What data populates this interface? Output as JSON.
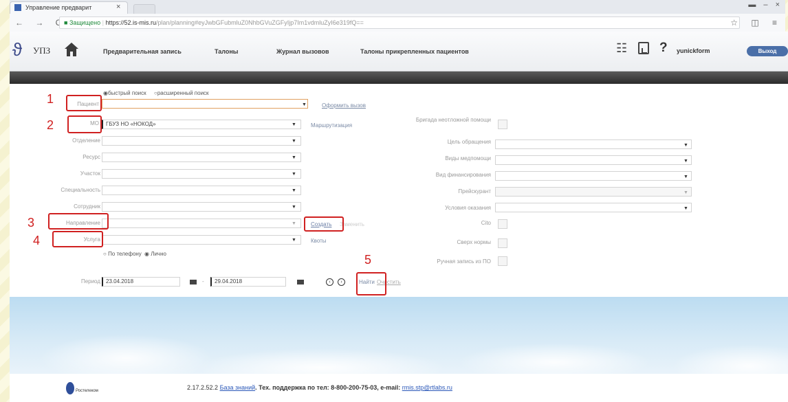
{
  "browser": {
    "tab_title": "Управление предварит",
    "tab_close": "×",
    "window_controls": "▬ – ×",
    "nav": "← → C",
    "url_secure_label": "Защищено",
    "url_base": "https://52.is-mis.ru",
    "url_path": "/plan/planning#eyJwbGFubmluZ0NhbGVuZGFyIjp7Im1vdmluZyI6e319fQ==",
    "right_icons": "☆ ◫ ≡"
  },
  "header": {
    "logo_text": "УПЗ",
    "menu": [
      {
        "label": "Предварительная запись"
      },
      {
        "label": "Талоны"
      },
      {
        "label": "Журнал вызовов"
      },
      {
        "label": "Талоны прикрепленных пациентов"
      }
    ],
    "help": "?",
    "username": "yunickform",
    "logout": "Выход"
  },
  "form": {
    "search_mode": {
      "quick": "быстрый поиск",
      "extended": "расширенный поиск"
    },
    "patient": {
      "label": "Пациент",
      "value": ""
    },
    "register_call": "Оформить вызов",
    "mo": {
      "label": "МО",
      "value": "ГБУЗ НО «НОКОД»"
    },
    "routing": "Маршрутизация",
    "department": {
      "label": "Отделение",
      "value": ""
    },
    "resource": {
      "label": "Ресурс",
      "value": ""
    },
    "district": {
      "label": "Участок",
      "value": ""
    },
    "specialty": {
      "label": "Специальность",
      "value": ""
    },
    "employee": {
      "label": "Сотрудник",
      "value": ""
    },
    "referral": {
      "label": "Направление",
      "value": ""
    },
    "create_button": "Создать",
    "referral_extra": "Заменить",
    "service": {
      "label": "Услуга",
      "value": ""
    },
    "quotas": "Квоты",
    "contact_mode": {
      "phone": "По телефону",
      "personal": "Лично"
    },
    "period": {
      "label": "Период",
      "from": "23.04.2018",
      "dash": "-",
      "to": "29.04.2018"
    },
    "prev_btn": "‹",
    "next_btn": "›",
    "find_button": "Найти",
    "clear_button": "Очистить",
    "right": {
      "emergency_team": "Бригада неотложной помощи",
      "visit_purpose": "Цель обращения",
      "payment_types": "Виды медпомощи",
      "funding_type": "Вид финансирования",
      "price_list": "Прейскурант",
      "care_conditions": "Условия оказания",
      "cito": "Cito",
      "over_norm": "Сверх нормы",
      "manual_from_ro": "Ручная запись из ПО"
    }
  },
  "annotations": [
    "1",
    "2",
    "3",
    "4",
    "5"
  ],
  "footer": {
    "version": "2.17.2.52.2",
    "kb_link": "База знаний",
    "support": ". Тех. поддержка по тел: 8-800-200-75-03, e-mail:",
    "email": "rmis.stp@rtlabs.ru",
    "provider": "Ростелеком"
  }
}
